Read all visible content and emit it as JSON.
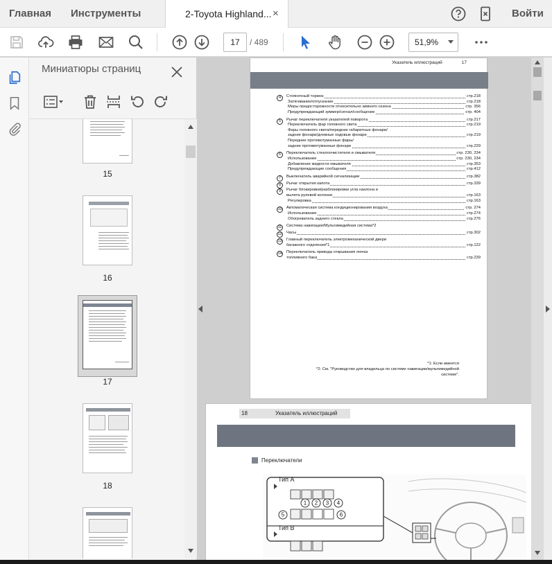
{
  "menubar": {
    "home_label": "Главная",
    "tools_label": "Инструменты",
    "doc_tab_title": "2-Toyota Highland...",
    "doc_tab_close": "×",
    "login_label": "Войти"
  },
  "toolbar": {
    "current_page": "17",
    "page_total": "/ 489",
    "zoom": "51,9%"
  },
  "panel": {
    "title": "Миниатюры страниц",
    "thumb_labels": [
      "15",
      "16",
      "17",
      "18"
    ]
  },
  "page17": {
    "header_title": "Указатель иллюстраций",
    "header_page": "17",
    "items": [
      {
        "num": "4",
        "lines": [
          {
            "text": "Стояночный тормоз",
            "page": "стр.218",
            "sub": false
          },
          {
            "text": "Затягивание/отпускание",
            "page": "стр.218",
            "sub": true
          },
          {
            "text": "Меры предосторожности относительно зимнего сезона",
            "page": "стр. 356",
            "sub": true
          },
          {
            "text": "Предупреждающий зуммер/сигнал/сообщение",
            "page": "стр. 404",
            "sub": true
          }
        ]
      },
      {
        "num": "5",
        "lines": [
          {
            "text": "Рычаг переключателя указателей поворота",
            "page": "стр.217",
            "sub": false
          },
          {
            "text": "Переключатель фар головного света",
            "page": "стр.219",
            "sub": true
          },
          {
            "text": "Фары головного света/передние габаритные фонари/",
            "page": "",
            "sub": true
          },
          {
            "text": "задние фонари/дневные ходовые фонари",
            "page": "стр.219",
            "sub": true
          },
          {
            "text": "Передние противотуманные фары/",
            "page": "",
            "sub": true
          },
          {
            "text": "задние противотуманные фонари",
            "page": "стр.229",
            "sub": true
          }
        ]
      },
      {
        "num": "6",
        "lines": [
          {
            "text": "Переключатель стеклоочистителя и омывателя",
            "page": "стр. 230, 234",
            "sub": false
          },
          {
            "text": "Использование",
            "page": "стр. 230, 234",
            "sub": true
          },
          {
            "text": "Добавление жидкости омывателя",
            "page": "стр.353",
            "sub": true
          },
          {
            "text": "Предупреждающие сообщения",
            "page": "стр.412",
            "sub": true
          }
        ]
      },
      {
        "num": "7",
        "lines": [
          {
            "text": "Выключатель аварийной сигнализации",
            "page": "стр.382",
            "sub": false
          }
        ]
      },
      {
        "num": "8",
        "lines": [
          {
            "text": "Рычаг открытия капота",
            "page": "стр.339",
            "sub": false
          }
        ]
      },
      {
        "num": "9",
        "lines": [
          {
            "text": "Рычаг блокировки/разблокировки угла наклона и",
            "page": "",
            "sub": false
          },
          {
            "text": "вылета рулевой колонки",
            "page": "стр.163",
            "sub": false
          },
          {
            "text": "Регулировка",
            "page": "стр.163",
            "sub": true
          }
        ]
      },
      {
        "num": "10",
        "lines": [
          {
            "text": "Автоматическая система кондиционирования воздуха",
            "page": "стр. 274",
            "sub": false
          },
          {
            "text": "Использование",
            "page": "стр.274",
            "sub": true
          },
          {
            "text": "Обогреватель заднего стекла",
            "page": "стр.276",
            "sub": true
          }
        ]
      },
      {
        "num": "11",
        "lines": [
          {
            "text": "Система навигации/Мультимедийная система*2",
            "page": "",
            "sub": false
          }
        ]
      },
      {
        "num": "12",
        "lines": [
          {
            "text": "Часы",
            "page": "стр.302",
            "sub": false
          }
        ]
      },
      {
        "num": "13",
        "lines": [
          {
            "text": "Главный переключатель электромеханической двери",
            "page": "",
            "sub": false
          },
          {
            "text": "багажного отделения*1",
            "page": "стр.122",
            "sub": false
          }
        ]
      },
      {
        "num": "14",
        "lines": [
          {
            "text": "Переключатель привода открывания лючка",
            "page": "",
            "sub": false
          },
          {
            "text": "топливного бака",
            "page": "стр.239",
            "sub": false
          }
        ]
      }
    ],
    "footnote1": "*1: Если имеется",
    "footnote2": "*2: См. \"Руководство для владельца по системе навигации/мультимедийной",
    "footnote3": "системе\"."
  },
  "page18": {
    "header_page": "18",
    "header_title": "Указатель иллюстраций",
    "section": "Переключатели",
    "type_a": "Тип A",
    "type_b": "Тип B",
    "callouts": [
      "1",
      "2",
      "3",
      "4",
      "5",
      "6"
    ]
  }
}
